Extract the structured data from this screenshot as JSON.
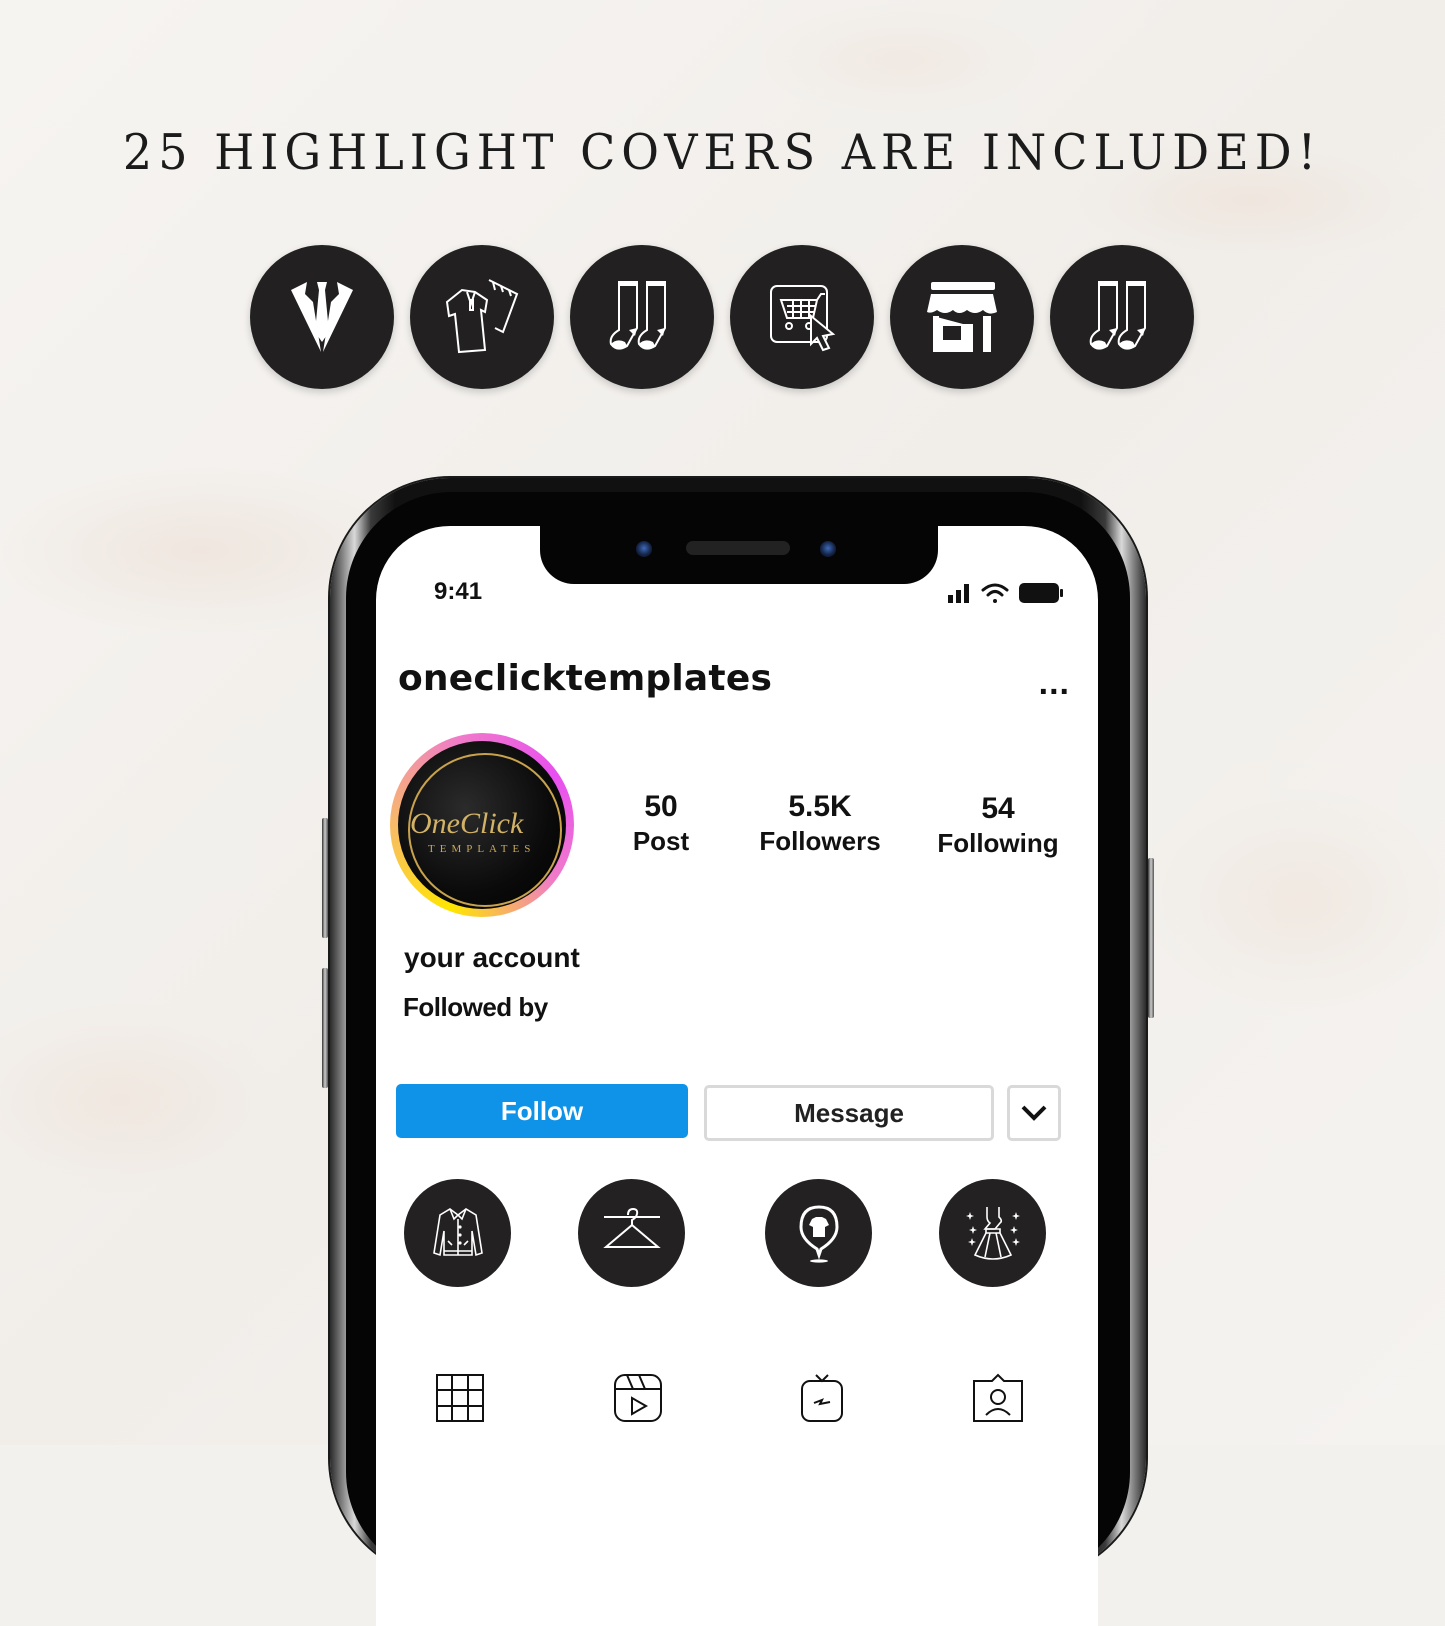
{
  "headline": "25 HIGHLIGHT COVERS ARE INCLUDED!",
  "covers": [
    {
      "icon": "suit-tie-icon"
    },
    {
      "icon": "folded-clothes-icon"
    },
    {
      "icon": "socks-icon"
    },
    {
      "icon": "online-shopping-cart-icon"
    },
    {
      "icon": "storefront-icon"
    },
    {
      "icon": "socks-icon"
    }
  ],
  "status_bar": {
    "time": "9:41",
    "icons": [
      "signal-icon",
      "wifi-icon",
      "battery-icon"
    ]
  },
  "profile": {
    "username": "oneclicktemplates",
    "more_label": "...",
    "avatar": {
      "logo_text": "OneClick",
      "logo_subtext": "TEMPLATES"
    },
    "stats": [
      {
        "value": "50",
        "label": "Post"
      },
      {
        "value": "5.5K",
        "label": "Followers"
      },
      {
        "value": "54",
        "label": "Following"
      }
    ],
    "display_name": "your account",
    "followed_by": "Followed by"
  },
  "actions": {
    "follow_label": "Follow",
    "message_label": "Message",
    "follow_color": "#0f93e8"
  },
  "highlights": [
    {
      "icon": "jacket-icon"
    },
    {
      "icon": "hanger-icon"
    },
    {
      "icon": "tshirt-location-pin-icon"
    },
    {
      "icon": "dress-sparkle-icon"
    }
  ],
  "tabs": [
    {
      "icon": "grid-icon"
    },
    {
      "icon": "reels-icon"
    },
    {
      "icon": "igtv-icon"
    },
    {
      "icon": "tagged-icon"
    }
  ]
}
